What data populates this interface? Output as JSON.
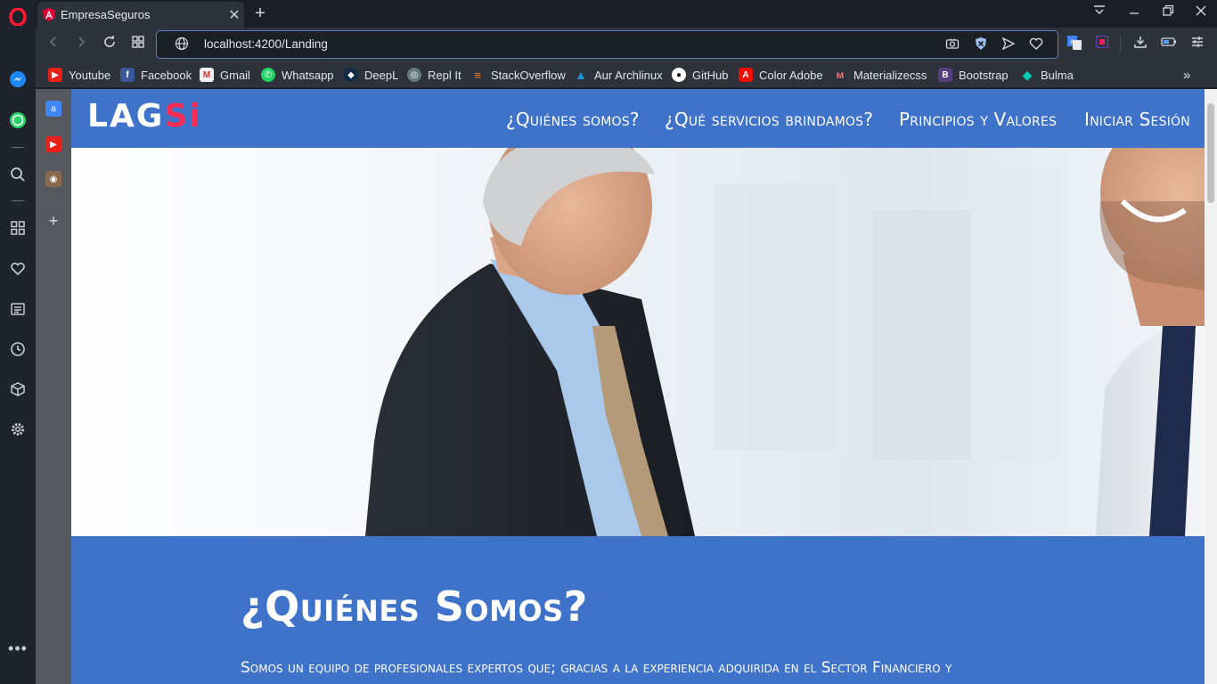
{
  "browser": {
    "tab": {
      "title": "EmpresaSeguros"
    },
    "url": "localhost:4200/Landing",
    "bookmarks": [
      {
        "label": "Youtube",
        "icon": "youtube-icon",
        "color": "#e62117"
      },
      {
        "label": "Facebook",
        "icon": "facebook-icon",
        "color": "#3b5998"
      },
      {
        "label": "Gmail",
        "icon": "gmail-icon",
        "color": "#d93025"
      },
      {
        "label": "Whatsapp",
        "icon": "whatsapp-icon",
        "color": "#25d366"
      },
      {
        "label": "DeepL",
        "icon": "deepl-icon",
        "color": "#0f2b46"
      },
      {
        "label": "Repl It",
        "icon": "replit-icon",
        "color": "#667881"
      },
      {
        "label": "StackOverflow",
        "icon": "stackoverflow-icon",
        "color": "#f48024"
      },
      {
        "label": "Aur Archlinux",
        "icon": "archlinux-icon",
        "color": "#1793d1"
      },
      {
        "label": "GitHub",
        "icon": "github-icon",
        "color": "#ffffff"
      },
      {
        "label": "Color Adobe",
        "icon": "adobe-icon",
        "color": "#eb1000"
      },
      {
        "label": "Materializecss",
        "icon": "materialize-icon",
        "color": "#ee6e73"
      },
      {
        "label": "Bootstrap",
        "icon": "bootstrap-icon",
        "color": "#563d7c"
      },
      {
        "label": "Bulma",
        "icon": "bulma-icon",
        "color": "#00d1b2"
      }
    ]
  },
  "site": {
    "logo": {
      "main": "LAG",
      "accent": "Si"
    },
    "nav": {
      "about": "¿Quiénes somos?",
      "services": "¿Qué servicios brindamos?",
      "values": "Principios y Valores",
      "login": "Iniciar Sesión"
    },
    "about": {
      "title": "¿Quiénes Somos?",
      "text": "Somos un equipo de profesionales expertos que; gracias a la experiencia adquirida en el Sector Financiero y"
    }
  },
  "colors": {
    "brand_blue": "#3f72c9",
    "logo_accent": "#ff2d55",
    "opera_red": "#ff1b2d"
  }
}
